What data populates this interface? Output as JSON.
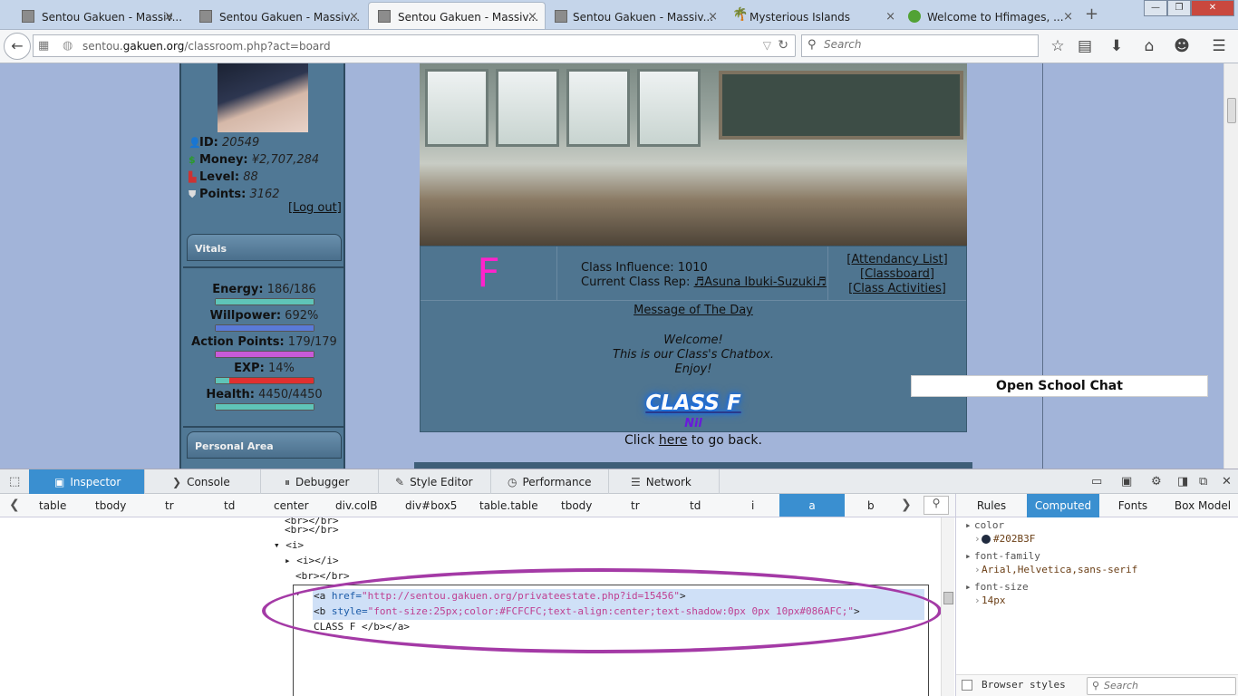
{
  "tabs": [
    {
      "title": "Sentou Gakuen - Massiv...",
      "icon": "school-favicon"
    },
    {
      "title": "Sentou Gakuen - Massiv...",
      "icon": "school-favicon"
    },
    {
      "title": "Sentou Gakuen - Massiv...",
      "icon": "school-favicon"
    },
    {
      "title": "Sentou Gakuen - Massiv...",
      "icon": "school-favicon"
    },
    {
      "title": "Mysterious Islands",
      "icon": "palm-favicon"
    },
    {
      "title": "Welcome to Hfimages, ...",
      "icon": "hf-favicon"
    }
  ],
  "tab_close_glyph": "×",
  "new_tab_glyph": "+",
  "window_controls": {
    "minimize": "—",
    "maximize": "❐",
    "close": "✕"
  },
  "nav": {
    "back_glyph": "←",
    "url_prefix": "sentou.",
    "url_domain": "gakuen.org",
    "url_path": "/classroom.php?act=board",
    "search_placeholder": "Search"
  },
  "toolbar_icons": [
    "star-icon",
    "reading-list-icon",
    "download-icon",
    "home-icon",
    "smiley-icon",
    "menu-icon"
  ],
  "profile": {
    "id_label": "ID:",
    "id_value": "20549",
    "money_label": "Money:",
    "money_value": "¥2,707,284",
    "level_label": "Level:",
    "level_value": "88",
    "points_label": "Points:",
    "points_value": "3162",
    "logout": "[Log out]"
  },
  "sidebar": {
    "vitals_heading": "Vitals",
    "personal_heading": "Personal Area",
    "vitals": [
      {
        "label": "Energy:",
        "value": "186/186",
        "fill": 1.0,
        "color": "#5fc4b8"
      },
      {
        "label": "Willpower:",
        "value": "692%",
        "fill": 1.0,
        "color": "#5a7ad8"
      },
      {
        "label": "Action Points:",
        "value": "179/179",
        "fill": 1.0,
        "color": "#c85ad8"
      },
      {
        "label": "EXP:",
        "value": "14%",
        "fill": 0.14,
        "color": "#5fc4b8"
      },
      {
        "label": "Health:",
        "value": "4450/4450",
        "fill": 1.0,
        "color": "#5fc4b8"
      }
    ]
  },
  "classroom": {
    "class_letter": "F",
    "influence_text": "Class Influence: 1010",
    "rep_label": "Current Class Rep:",
    "rep_name": "♬Asuna Ibuki-Suzuki♬",
    "links": [
      "[Attendancy List]",
      "[Classboard]",
      "[Class Activities]"
    ],
    "motd_heading": "Message of The Day",
    "motd_lines": [
      "Welcome!",
      "This is our Class's Chatbox.",
      "Enjoy!"
    ],
    "class_title": "CLASS F",
    "nil_text": "Nil",
    "go_back_pre": "Click ",
    "go_back_link": "here",
    "go_back_post": " to go back.",
    "open_chat": "Open School Chat"
  },
  "devtools": {
    "tabs": [
      "Inspector",
      "Console",
      "Debugger",
      "Style Editor",
      "Performance",
      "Network"
    ],
    "active_tab": "Inspector",
    "breadcrumbs": [
      "table",
      "tbody",
      "tr",
      "td",
      "center",
      "div.colB",
      "div#box5",
      "table.table",
      "tbody",
      "tr",
      "td",
      "i",
      "a",
      "b"
    ],
    "active_crumb": "a",
    "markup_lines": [
      "<br></br>",
      "<br></br>",
      "<i>",
      "<i></i>",
      "<br></br>"
    ],
    "sel_a_tag": "<a",
    "sel_a_attr": " href=",
    "sel_a_val": "\"http://sentou.gakuen.org/privateestate.php?id=15456\"",
    "sel_a_close": ">",
    "sel_b_tag": "<b",
    "sel_b_attr": " style=",
    "sel_b_val": "\"font-size:25px;color:#FCFCFC;text-align:center;text-shadow:0px 0px 10px#086AFC;\"",
    "sel_b_close": ">",
    "sel_line3": "CLASS F </b></a>",
    "right_tabs": [
      "Rules",
      "Computed",
      "Fonts",
      "Box Model"
    ],
    "active_right_tab": "Computed",
    "computed": [
      {
        "prop": "color",
        "value": "#202B3F"
      },
      {
        "prop": "font-family",
        "value": "Arial,Helvetica,sans-serif"
      },
      {
        "prop": "font-size",
        "value": "14px"
      }
    ],
    "browser_styles_label": "Browser styles",
    "right_search_placeholder": "Search"
  }
}
